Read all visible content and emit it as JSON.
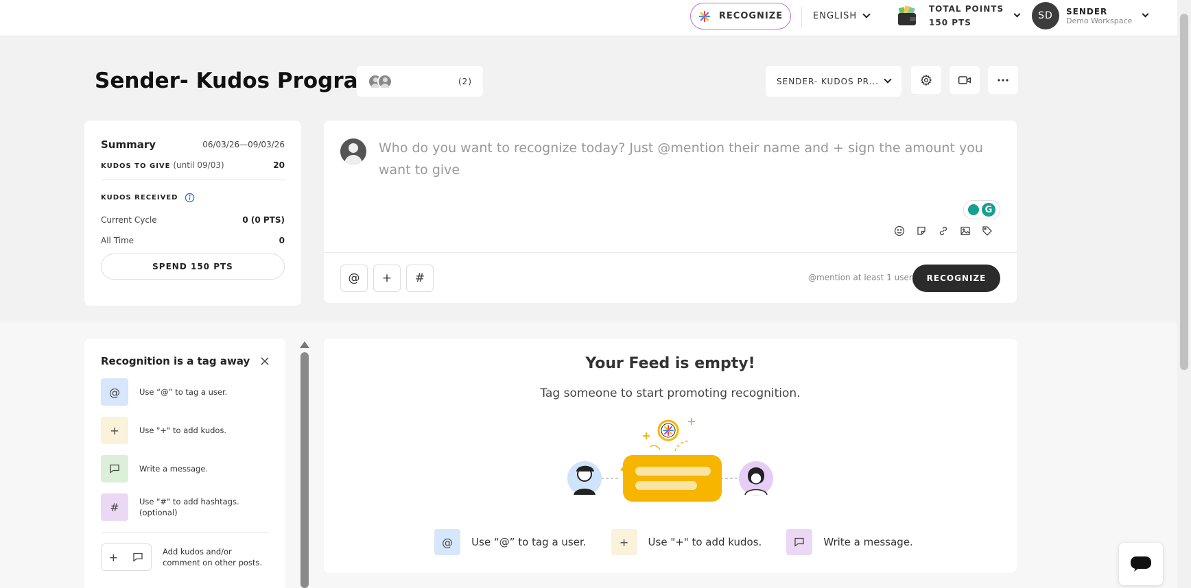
{
  "topbar": {
    "recognize_label": "RECOGNIZE",
    "language": "ENGLISH",
    "points_label": "TOTAL POINTS",
    "points_value": "150 PTS",
    "user_initials": "SD",
    "user_name": "SENDER",
    "workspace": "Demo Workspace"
  },
  "header": {
    "title": "Sender- Kudos Program",
    "members_count": "(2)",
    "program_select": "SENDER- KUDOS PR..."
  },
  "summary": {
    "title": "Summary",
    "date_range": "06/03/26—09/03/26",
    "kudos_to_give_label": "KUDOS TO GIVE",
    "kudos_to_give_until": "(until 09/03)",
    "kudos_to_give_value": "20",
    "kudos_received_label": "KUDOS RECEIVED",
    "current_cycle_label": "Current Cycle",
    "current_cycle_value": "0 (0 PTS)",
    "all_time_label": "All Time",
    "all_time_value": "0",
    "spend_label": "SPEND 150 PTS"
  },
  "composer": {
    "placeholder": "Who do you want to recognize today? Just @mention their name and + sign the amount you want to give",
    "mention_btn": "@",
    "plus_btn": "+",
    "hash_btn": "#",
    "hint": "@mention at least 1 user",
    "recognize_label": "RECOGNIZE",
    "grammarly_letter": "G"
  },
  "tips": {
    "title": "Recognition is a tag away",
    "items": [
      {
        "icon": "@",
        "text": "Use “@” to tag a user.",
        "color": "#d6e6fb"
      },
      {
        "icon": "+",
        "text": "Use \"+\" to add kudos.",
        "color": "#fbf2dc"
      },
      {
        "icon": "message-icon",
        "text": "Write a message.",
        "color": "#dcefd8"
      },
      {
        "icon": "#",
        "text": "Use \"#\" to add hashtags. (optional)",
        "color": "#ead8f5"
      }
    ],
    "combo_text": "Add kudos and/or comment on other posts.",
    "combo_plus": "+"
  },
  "feed": {
    "title": "Your Feed is empty!",
    "subtitle": "Tag someone to start promoting recognition.",
    "steps": [
      {
        "icon": "@",
        "text": "Use “@” to tag a user.",
        "color": "#d6e6fb"
      },
      {
        "icon": "+",
        "text": "Use \"+\" to add kudos.",
        "color": "#fbf2dc"
      },
      {
        "icon": "message-icon",
        "text": "Write a message.",
        "color": "#ead8f5"
      }
    ]
  },
  "colors": {
    "accent": "#c46bd0",
    "dark_button": "#2b2b2b",
    "illustration_yellow": "#f7b500"
  }
}
